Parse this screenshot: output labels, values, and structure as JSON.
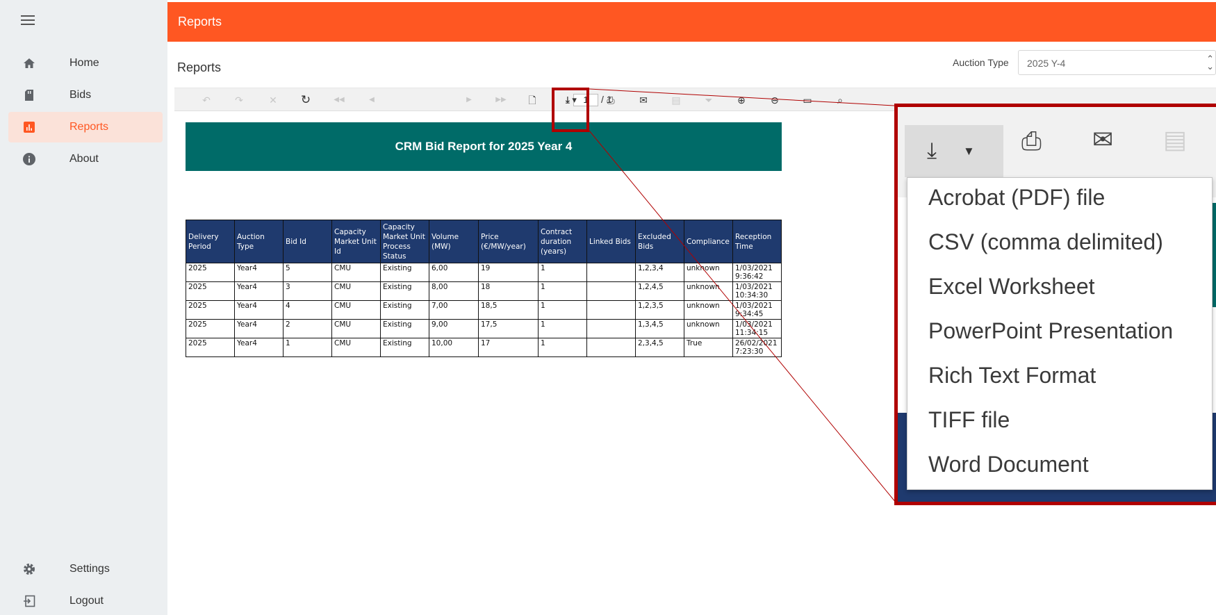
{
  "sidebar": {
    "items": [
      {
        "label": "Home",
        "icon": "home-icon"
      },
      {
        "label": "Bids",
        "icon": "document-icon"
      },
      {
        "label": "Reports",
        "icon": "bar-chart-icon",
        "active": true
      },
      {
        "label": "About",
        "icon": "info-icon"
      }
    ],
    "settings_label": "Settings",
    "logout_label": "Logout"
  },
  "header": {
    "title": "Reports"
  },
  "main": {
    "title": "Reports",
    "auction_type_label": "Auction Type",
    "auction_type_value": "2025 Y-4"
  },
  "viewer": {
    "page_current": "1",
    "page_total": "/ 1"
  },
  "report": {
    "title": "CRM Bid Report for 2025  Year 4",
    "columns": [
      "Delivery Period",
      "Auction Type",
      "Bid Id",
      "Capacity Market Unit Id",
      "Capacity Market Unit Process Status",
      "Volume (MW)",
      "Price (€/MW/year)",
      "Contract duration (years)",
      "Linked Bids",
      "Excluded Bids",
      "Compliance",
      "Reception Time"
    ],
    "rows": [
      [
        "2025",
        "Year4",
        "5",
        "CMU",
        "Existing",
        "6,00",
        "19",
        "1",
        "",
        "1,2,3,4",
        "unknown",
        "1/03/2021 9:36:42"
      ],
      [
        "2025",
        "Year4",
        "3",
        "CMU",
        "Existing",
        "8,00",
        "18",
        "1",
        "",
        "1,2,4,5",
        "unknown",
        "1/03/2021 10:34:30"
      ],
      [
        "2025",
        "Year4",
        "4",
        "CMU",
        "Existing",
        "7,00",
        "18,5",
        "1",
        "",
        "1,2,3,5",
        "unknown",
        "1/03/2021 9:34:45"
      ],
      [
        "2025",
        "Year4",
        "2",
        "CMU",
        "Existing",
        "9,00",
        "17,5",
        "1",
        "",
        "1,3,4,5",
        "unknown",
        "1/03/2021 11:34:15"
      ],
      [
        "2025",
        "Year4",
        "1",
        "CMU",
        "Existing",
        "10,00",
        "17",
        "1",
        "",
        "2,3,4,5",
        "True",
        "26/02/2021 7:23:30"
      ]
    ]
  },
  "export_menu": {
    "items": [
      "Acrobat (PDF) file",
      "CSV (comma delimited)",
      "Excel Worksheet",
      "PowerPoint Presentation",
      "Rich Text Format",
      "TIFF file",
      "Word Document"
    ]
  },
  "colors": {
    "accent": "#ff5722",
    "banner": "#006b68",
    "table_header": "#1f3a6e",
    "highlight": "#b00000"
  }
}
